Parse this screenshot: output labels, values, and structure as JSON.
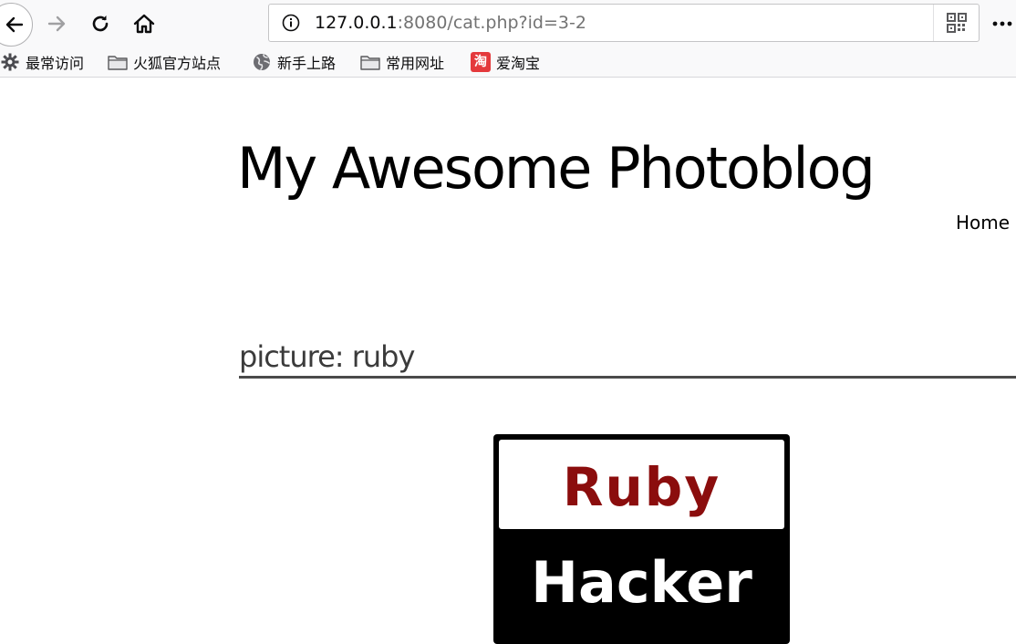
{
  "browser": {
    "url": {
      "host": "127.0.0.1",
      "rest": ":8080/cat.php?id=3-2"
    },
    "bookmarks": [
      {
        "label": "最常访问",
        "icon": "gear-icon"
      },
      {
        "label": "火狐官方站点",
        "icon": "folder-icon"
      },
      {
        "label": "新手上路",
        "icon": "globe-icon"
      },
      {
        "label": "常用网址",
        "icon": "folder-icon"
      },
      {
        "label": "爱淘宝",
        "icon": "taobao-icon",
        "icon_text": "淘",
        "icon_color": "#e4393c"
      }
    ]
  },
  "page": {
    "site_title": "My Awesome Photoblog",
    "nav": {
      "home": "Home"
    },
    "picture_heading": "picture: ruby",
    "photo": {
      "top_text": "Ruby",
      "bottom_text": "Hacker",
      "top_color": "#8b0d0d"
    }
  }
}
